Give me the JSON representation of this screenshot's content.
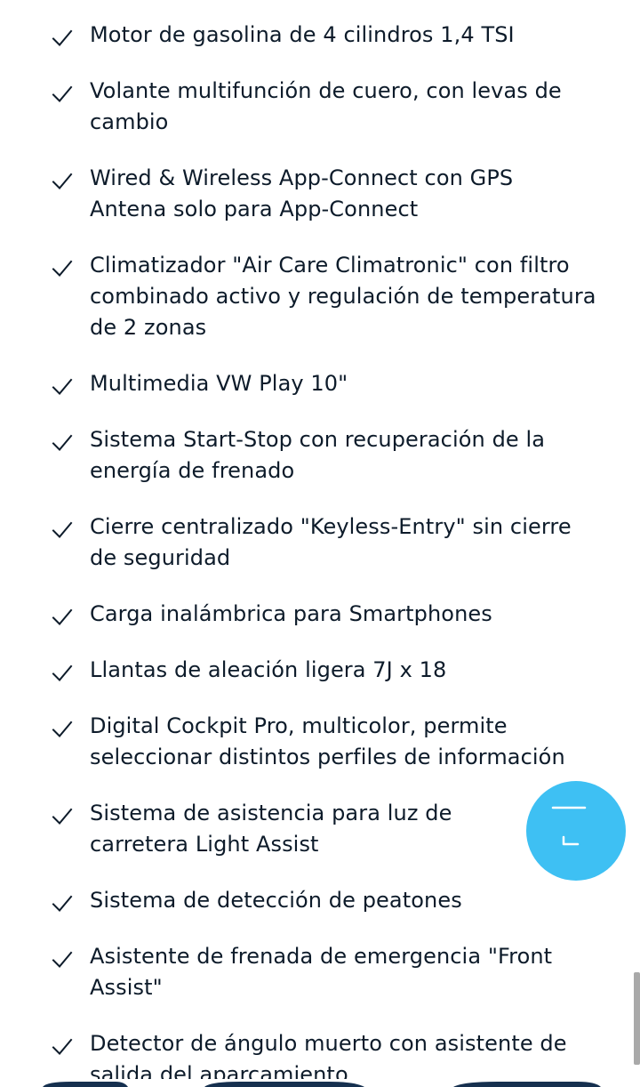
{
  "features": [
    {
      "text": "Motor de gasolina de 4 cilindros 1,4 TSI"
    },
    {
      "text": "Volante multifunción de cuero, con levas de cambio"
    },
    {
      "text": "Wired & Wireless App-Connect con GPS Antena solo para App-Connect"
    },
    {
      "text": "Climatizador \"Air Care Climatronic\" con filtro combinado activo y regulación de temperatura de 2 zonas"
    },
    {
      "text": "Multimedia VW Play 10\""
    },
    {
      "text": "Sistema Start-Stop con recuperación de la energía de frenado"
    },
    {
      "text": "Cierre centralizado \"Keyless-Entry\" sin cierre de seguridad"
    },
    {
      "text": "Carga inalámbrica para Smartphones"
    },
    {
      "text": "Llantas de aleación ligera 7J x 18"
    },
    {
      "text": "Digital Cockpit Pro, multicolor, permite seleccionar distintos perfiles de información"
    },
    {
      "text": "Sistema de asistencia para luz de carretera Light Assist"
    },
    {
      "text": "Sistema de detección de peatones"
    },
    {
      "text": "Asistente de frenada de emergencia \"Front Assist\""
    },
    {
      "text": "Detector de ángulo muerto con asistente de salida del aparcamiento"
    }
  ],
  "icons": {
    "check": "check-icon",
    "fab": "chat-icon"
  },
  "colors": {
    "text": "#0d1b2a",
    "check": "#0d1b2a",
    "fab_background": "#3ec0f3",
    "fab_icon": "#ffffff",
    "scrollbar": "#a9a9a9"
  }
}
